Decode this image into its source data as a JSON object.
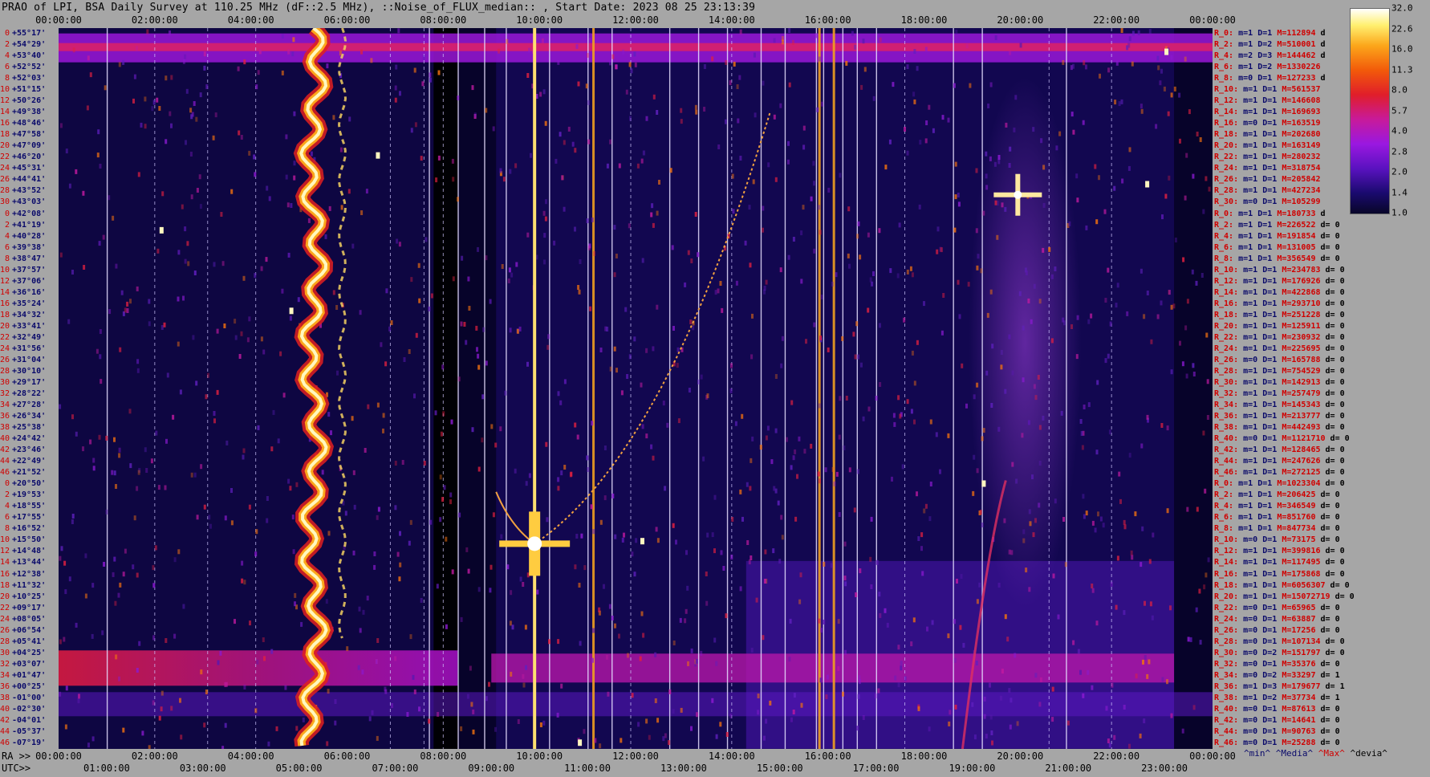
{
  "title": "PRAO of LPI, BSA Daily Survey at 110.25 MHz (dF::2.5 MHz), ::Noise_of_FLUX_median:: , Start Date: 2023 08 25 23:13:39",
  "top_axis_ticks": [
    "00:00:00",
    "02:00:00",
    "04:00:00",
    "06:00:00",
    "08:00:00",
    "10:00:00",
    "12:00:00",
    "14:00:00",
    "16:00:00",
    "18:00:00",
    "20:00:00",
    "22:00:00",
    "00:00:00"
  ],
  "bottom_ra": {
    "label": "RA >>",
    "ticks": [
      "00:00:00",
      "02:00:00",
      "04:00:00",
      "06:00:00",
      "08:00:00",
      "10:00:00",
      "12:00:00",
      "14:00:00",
      "16:00:00",
      "18:00:00",
      "20:00:00",
      "22:00:00",
      "00:00:00"
    ]
  },
  "bottom_utc": {
    "label": "UTC>>",
    "ticks": [
      "01:00:00",
      "03:00:00",
      "05:00:00",
      "07:00:00",
      "09:00:00",
      "11:00:00",
      "13:00:00",
      "15:00:00",
      "17:00:00",
      "19:00:00",
      "21:00:00",
      "23:00:00"
    ]
  },
  "left_rows": [
    {
      "i": "0",
      "dec": "+55°17'"
    },
    {
      "i": "2",
      "dec": "+54°29'"
    },
    {
      "i": "4",
      "dec": "+53°40'"
    },
    {
      "i": "6",
      "dec": "+52°52'"
    },
    {
      "i": "8",
      "dec": "+52°03'"
    },
    {
      "i": "10",
      "dec": "+51°15'"
    },
    {
      "i": "12",
      "dec": "+50°26'"
    },
    {
      "i": "14",
      "dec": "+49°38'"
    },
    {
      "i": "16",
      "dec": "+48°46'"
    },
    {
      "i": "18",
      "dec": "+47°58'"
    },
    {
      "i": "20",
      "dec": "+47°09'"
    },
    {
      "i": "22",
      "dec": "+46°20'"
    },
    {
      "i": "24",
      "dec": "+45°31'"
    },
    {
      "i": "26",
      "dec": "+44°41'"
    },
    {
      "i": "28",
      "dec": "+43°52'"
    },
    {
      "i": "30",
      "dec": "+43°03'"
    },
    {
      "i": "0",
      "dec": "+42°08'"
    },
    {
      "i": "2",
      "dec": "+41°19'"
    },
    {
      "i": "4",
      "dec": "+40°28'"
    },
    {
      "i": "6",
      "dec": "+39°38'"
    },
    {
      "i": "8",
      "dec": "+38°47'"
    },
    {
      "i": "10",
      "dec": "+37°57'"
    },
    {
      "i": "12",
      "dec": "+37°06'"
    },
    {
      "i": "14",
      "dec": "+36°16'"
    },
    {
      "i": "16",
      "dec": "+35°24'"
    },
    {
      "i": "18",
      "dec": "+34°32'"
    },
    {
      "i": "20",
      "dec": "+33°41'"
    },
    {
      "i": "22",
      "dec": "+32°49'"
    },
    {
      "i": "24",
      "dec": "+31°56'"
    },
    {
      "i": "26",
      "dec": "+31°04'"
    },
    {
      "i": "28",
      "dec": "+30°10'"
    },
    {
      "i": "30",
      "dec": "+29°17'"
    },
    {
      "i": "32",
      "dec": "+28°22'"
    },
    {
      "i": "34",
      "dec": "+27°28'"
    },
    {
      "i": "36",
      "dec": "+26°34'"
    },
    {
      "i": "38",
      "dec": "+25°38'"
    },
    {
      "i": "40",
      "dec": "+24°42'"
    },
    {
      "i": "42",
      "dec": "+23°46'"
    },
    {
      "i": "44",
      "dec": "+22°49'"
    },
    {
      "i": "46",
      "dec": "+21°52'"
    },
    {
      "i": "0",
      "dec": "+20°50'"
    },
    {
      "i": "2",
      "dec": "+19°53'"
    },
    {
      "i": "4",
      "dec": "+18°55'"
    },
    {
      "i": "6",
      "dec": "+17°55'"
    },
    {
      "i": "8",
      "dec": "+16°52'"
    },
    {
      "i": "10",
      "dec": "+15°50'"
    },
    {
      "i": "12",
      "dec": "+14°48'"
    },
    {
      "i": "14",
      "dec": "+13°44'"
    },
    {
      "i": "16",
      "dec": "+12°38'"
    },
    {
      "i": "18",
      "dec": "+11°32'"
    },
    {
      "i": "20",
      "dec": "+10°25'"
    },
    {
      "i": "22",
      "dec": "+09°17'"
    },
    {
      "i": "24",
      "dec": "+08°05'"
    },
    {
      "i": "26",
      "dec": "+06°54'"
    },
    {
      "i": "28",
      "dec": "+05°41'"
    },
    {
      "i": "30",
      "dec": "+04°25'"
    },
    {
      "i": "32",
      "dec": "+03°07'"
    },
    {
      "i": "34",
      "dec": "+01°47'"
    },
    {
      "i": "36",
      "dec": "+00°25'"
    },
    {
      "i": "38",
      "dec": "-01°00'"
    },
    {
      "i": "40",
      "dec": "-02°30'"
    },
    {
      "i": "42",
      "dec": "-04°01'"
    },
    {
      "i": "44",
      "dec": "-05°37'"
    },
    {
      "i": "46",
      "dec": "-07°19'"
    }
  ],
  "right_rows": [
    {
      "r": "R_0:",
      "md": "m=1 D=1",
      "mx": "M=112894",
      "dv": "d"
    },
    {
      "r": "R_2:",
      "md": "m=1 D=2",
      "mx": "M=510001",
      "dv": "d"
    },
    {
      "r": "R_4:",
      "md": "m=2 D=3",
      "mx": "M=144462",
      "dv": "d"
    },
    {
      "r": "R_6:",
      "md": "m=1 D=2",
      "mx": "M=1330226",
      "dv": ""
    },
    {
      "r": "R_8:",
      "md": "m=0 D=1",
      "mx": "M=127233",
      "dv": "d"
    },
    {
      "r": "R_10:",
      "md": "m=1 D=1",
      "mx": "M=561537",
      "dv": ""
    },
    {
      "r": "R_12:",
      "md": "m=1 D=1",
      "mx": "M=146608",
      "dv": ""
    },
    {
      "r": "R_14:",
      "md": "m=1 D=1",
      "mx": "M=169693",
      "dv": ""
    },
    {
      "r": "R_16:",
      "md": "m=0 D=1",
      "mx": "M=163519",
      "dv": ""
    },
    {
      "r": "R_18:",
      "md": "m=1 D=1",
      "mx": "M=202680",
      "dv": ""
    },
    {
      "r": "R_20:",
      "md": "m=1 D=1",
      "mx": "M=163149",
      "dv": ""
    },
    {
      "r": "R_22:",
      "md": "m=1 D=1",
      "mx": "M=280232",
      "dv": ""
    },
    {
      "r": "R_24:",
      "md": "m=1 D=1",
      "mx": "M=318754",
      "dv": ""
    },
    {
      "r": "R_26:",
      "md": "m=1 D=1",
      "mx": "M=205842",
      "dv": ""
    },
    {
      "r": "R_28:",
      "md": "m=1 D=1",
      "mx": "M=427234",
      "dv": ""
    },
    {
      "r": "R_30:",
      "md": "m=0 D=1",
      "mx": "M=105299",
      "dv": ""
    },
    {
      "r": "R_0:",
      "md": "m=1 D=1",
      "mx": "M=180733",
      "dv": "d"
    },
    {
      "r": "R_2:",
      "md": "m=1 D=1",
      "mx": "M=226522",
      "dv": "d= 0"
    },
    {
      "r": "R_4:",
      "md": "m=1 D=1",
      "mx": "M=191854",
      "dv": "d= 0"
    },
    {
      "r": "R_6:",
      "md": "m=1 D=1",
      "mx": "M=131005",
      "dv": "d= 0"
    },
    {
      "r": "R_8:",
      "md": "m=1 D=1",
      "mx": "M=356549",
      "dv": "d= 0"
    },
    {
      "r": "R_10:",
      "md": "m=1 D=1",
      "mx": "M=234783",
      "dv": "d= 0"
    },
    {
      "r": "R_12:",
      "md": "m=1 D=1",
      "mx": "M=176926",
      "dv": "d= 0"
    },
    {
      "r": "R_14:",
      "md": "m=1 D=1",
      "mx": "M=422868",
      "dv": "d= 0"
    },
    {
      "r": "R_16:",
      "md": "m=1 D=1",
      "mx": "M=293710",
      "dv": "d= 0"
    },
    {
      "r": "R_18:",
      "md": "m=1 D=1",
      "mx": "M=251228",
      "dv": "d= 0"
    },
    {
      "r": "R_20:",
      "md": "m=1 D=1",
      "mx": "M=125911",
      "dv": "d= 0"
    },
    {
      "r": "R_22:",
      "md": "m=1 D=1",
      "mx": "M=230932",
      "dv": "d= 0"
    },
    {
      "r": "R_24:",
      "md": "m=1 D=1",
      "mx": "M=225695",
      "dv": "d= 0"
    },
    {
      "r": "R_26:",
      "md": "m=0 D=1",
      "mx": "M=165788",
      "dv": "d= 0"
    },
    {
      "r": "R_28:",
      "md": "m=1 D=1",
      "mx": "M=754529",
      "dv": "d= 0"
    },
    {
      "r": "R_30:",
      "md": "m=1 D=1",
      "mx": "M=142913",
      "dv": "d= 0"
    },
    {
      "r": "R_32:",
      "md": "m=1 D=1",
      "mx": "M=257479",
      "dv": "d= 0"
    },
    {
      "r": "R_34:",
      "md": "m=1 D=1",
      "mx": "M=145343",
      "dv": "d= 0"
    },
    {
      "r": "R_36:",
      "md": "m=1 D=1",
      "mx": "M=213777",
      "dv": "d= 0"
    },
    {
      "r": "R_38:",
      "md": "m=1 D=1",
      "mx": "M=442493",
      "dv": "d= 0"
    },
    {
      "r": "R_40:",
      "md": "m=0 D=1",
      "mx": "M=1121710",
      "dv": "d= 0"
    },
    {
      "r": "R_42:",
      "md": "m=1 D=1",
      "mx": "M=128465",
      "dv": "d= 0"
    },
    {
      "r": "R_44:",
      "md": "m=1 D=1",
      "mx": "M=247626",
      "dv": "d= 0"
    },
    {
      "r": "R_46:",
      "md": "m=1 D=1",
      "mx": "M=272125",
      "dv": "d= 0"
    },
    {
      "r": "R_0:",
      "md": "m=1 D=1",
      "mx": "M=1023304",
      "dv": "d= 0"
    },
    {
      "r": "R_2:",
      "md": "m=1 D=1",
      "mx": "M=206425",
      "dv": "d= 0"
    },
    {
      "r": "R_4:",
      "md": "m=1 D=1",
      "mx": "M=346549",
      "dv": "d= 0"
    },
    {
      "r": "R_6:",
      "md": "m=1 D=1",
      "mx": "M=851760",
      "dv": "d= 0"
    },
    {
      "r": "R_8:",
      "md": "m=1 D=1",
      "mx": "M=847734",
      "dv": "d= 0"
    },
    {
      "r": "R_10:",
      "md": "m=0 D=1",
      "mx": "M=73175",
      "dv": "d= 0"
    },
    {
      "r": "R_12:",
      "md": "m=1 D=1",
      "mx": "M=399816",
      "dv": "d= 0"
    },
    {
      "r": "R_14:",
      "md": "m=1 D=1",
      "mx": "M=117495",
      "dv": "d= 0"
    },
    {
      "r": "R_16:",
      "md": "m=1 D=1",
      "mx": "M=175868",
      "dv": "d= 0"
    },
    {
      "r": "R_18:",
      "md": "m=1 D=1",
      "mx": "M=6056307",
      "dv": "d= 0"
    },
    {
      "r": "R_20:",
      "md": "m=1 D=1",
      "mx": "M=15072719",
      "dv": "d= 0"
    },
    {
      "r": "R_22:",
      "md": "m=0 D=1",
      "mx": "M=65965",
      "dv": "d= 0"
    },
    {
      "r": "R_24:",
      "md": "m=0 D=1",
      "mx": "M=63887",
      "dv": "d= 0"
    },
    {
      "r": "R_26:",
      "md": "m=0 D=1",
      "mx": "M=17256",
      "dv": "d= 0"
    },
    {
      "r": "R_28:",
      "md": "m=0 D=1",
      "mx": "M=107134",
      "dv": "d= 0"
    },
    {
      "r": "R_30:",
      "md": "m=0 D=2",
      "mx": "M=151797",
      "dv": "d= 0"
    },
    {
      "r": "R_32:",
      "md": "m=0 D=1",
      "mx": "M=35376",
      "dv": "d= 0"
    },
    {
      "r": "R_34:",
      "md": "m=0 D=2",
      "mx": "M=33297",
      "dv": "d= 1"
    },
    {
      "r": "R_36:",
      "md": "m=1 D=3",
      "mx": "M=179677",
      "dv": "d= 1"
    },
    {
      "r": "R_38:",
      "md": "m=1 D=2",
      "mx": "M=37734",
      "dv": "d= 1"
    },
    {
      "r": "R_40:",
      "md": "m=0 D=1",
      "mx": "M=87613",
      "dv": "d= 0"
    },
    {
      "r": "R_42:",
      "md": "m=0 D=1",
      "mx": "M=14641",
      "dv": "d= 0"
    },
    {
      "r": "R_44:",
      "md": "m=0 D=1",
      "mx": "M=90763",
      "dv": "d= 0"
    },
    {
      "r": "R_46:",
      "md": "m=0 D=1",
      "mx": "M=25288",
      "dv": "d= 0"
    }
  ],
  "colorbar_ticks": [
    "32.0",
    "22.6",
    "16.0",
    "11.3",
    "8.0",
    "5.7",
    "4.0",
    "2.8",
    "2.0",
    "1.4",
    "1.0"
  ],
  "footer_legend": {
    "min": "^min^",
    "media": "^Media^",
    "max": "^Max^",
    "devia": "^devia^"
  },
  "chart_data": {
    "type": "heatmap",
    "title": "PRAO of LPI, BSA Daily Survey at 110.25 MHz (dF::2.5 MHz), ::Noise_of_FLUX_median:: , Start Date: 2023 08 25 23:13:39",
    "x_axis_ra_hours": [
      0,
      24
    ],
    "y_axis_declination_deg": [
      55.28,
      -7.32
    ],
    "color_scale": "log",
    "color_range": [
      1.0,
      32.0
    ],
    "features": [
      {
        "name": "source_track_ra_5h",
        "x_ra_hours": 5.3,
        "kind": "vertical_strong"
      },
      {
        "name": "bright_source",
        "x_ra_hours": 9.9,
        "y_dec_deg": 10.5,
        "kind": "cross"
      },
      {
        "name": "bright_source",
        "x_ra_hours": 19.95,
        "y_dec_deg": 40.8,
        "kind": "cross"
      },
      {
        "name": "bright_band",
        "y_dec_deg": 53.7,
        "kind": "horizontal"
      },
      {
        "name": "bright_band",
        "y_dec_deg": -0.3,
        "kind": "horizontal"
      }
    ]
  }
}
